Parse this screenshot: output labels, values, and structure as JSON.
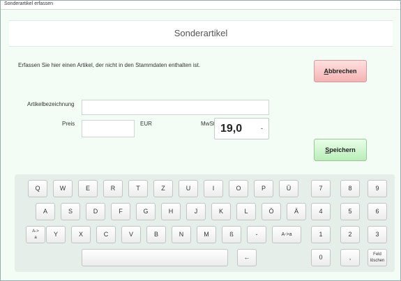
{
  "window": {
    "title": "Sonderartikel erfassen"
  },
  "header": {
    "title": "Sonderartikel"
  },
  "form": {
    "info": "Erfassen Sie hier einen Artikel, der nicht in den Stammdaten enthalten ist.",
    "article_label": "Artikelbezeichnung",
    "article_value": "",
    "price_label": "Preis",
    "price_value": "",
    "currency": "EUR",
    "tax_label": "MwSt",
    "tax_value": "19,0",
    "tax_arrow": "-"
  },
  "buttons": {
    "cancel": {
      "underlined": "A",
      "rest": "bbrechen"
    },
    "save": {
      "underlined": "S",
      "rest": "peichern"
    }
  },
  "keyboard": {
    "row1": [
      "Q",
      "W",
      "E",
      "R",
      "T",
      "Z",
      "U",
      "I",
      "O",
      "P",
      "Ü"
    ],
    "row2": [
      "A",
      "S",
      "D",
      "F",
      "G",
      "H",
      "J",
      "K",
      "L",
      "Ö",
      "Ä"
    ],
    "row3_shift": {
      "line1": "A->",
      "line2": "a"
    },
    "row3": [
      "Y",
      "X",
      "C",
      "V",
      "B",
      "N",
      "M",
      "ß",
      "-"
    ],
    "row3_case": "A->a",
    "backspace": "←",
    "num_row1": [
      "7",
      "8",
      "9"
    ],
    "num_row2": [
      "4",
      "5",
      "6"
    ],
    "num_row3": [
      "1",
      "2",
      "3"
    ],
    "zero": "0",
    "comma": ",",
    "clear": {
      "line1": "Feld",
      "line2": "löschen"
    }
  }
}
